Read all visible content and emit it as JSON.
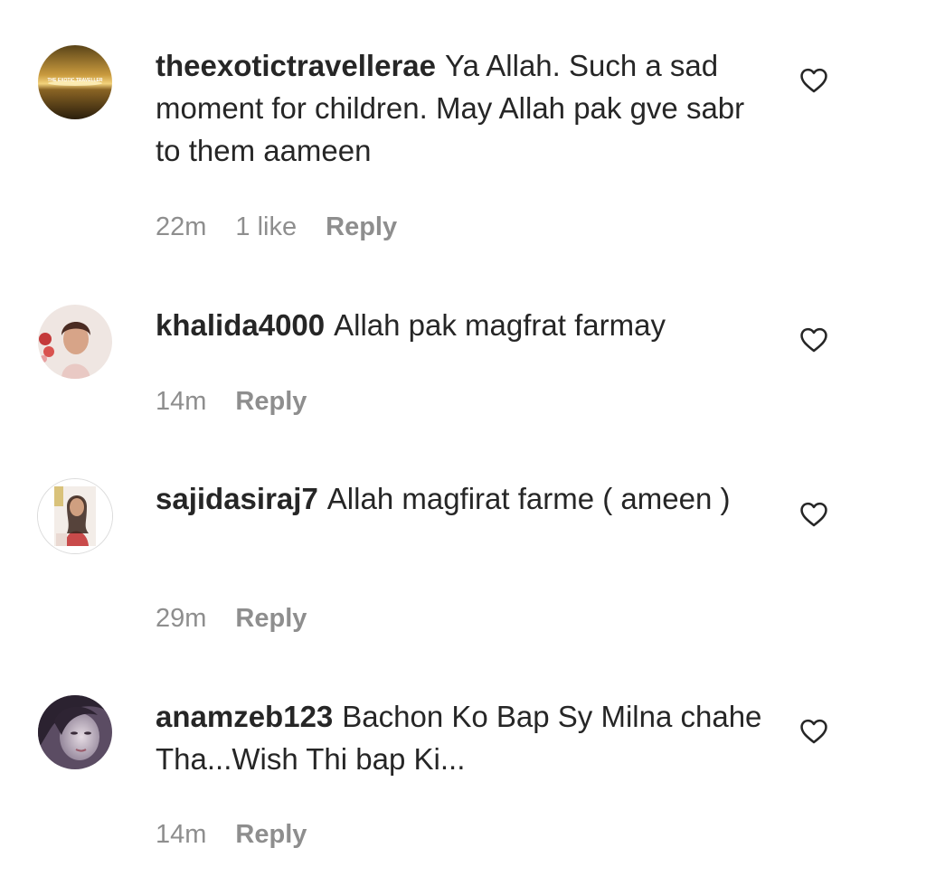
{
  "comments": [
    {
      "username": "theexotictravellerae",
      "text": "Ya Allah. Such a sad moment for children. May Allah pak gve sabr to them aameen",
      "time": "22m",
      "likes": "1 like",
      "reply": "Reply",
      "avatar_text": "THE EXOTIC TRAVELLER"
    },
    {
      "username": "khalida4000",
      "text": "Allah pak magfrat farmay",
      "time": "14m",
      "reply": "Reply"
    },
    {
      "username": "sajidasiraj7",
      "text": "Allah magfirat farme ( ameen )",
      "time": "29m",
      "reply": "Reply"
    },
    {
      "username": "anamzeb123",
      "text": "Bachon Ko Bap Sy Milna chahe Tha...Wish Thi bap Ki...",
      "time": "14m",
      "reply": "Reply"
    }
  ],
  "icons": {
    "like": "heart-outline-icon"
  },
  "colors": {
    "text": "#262626",
    "meta": "#8e8e8e",
    "background": "#ffffff"
  }
}
